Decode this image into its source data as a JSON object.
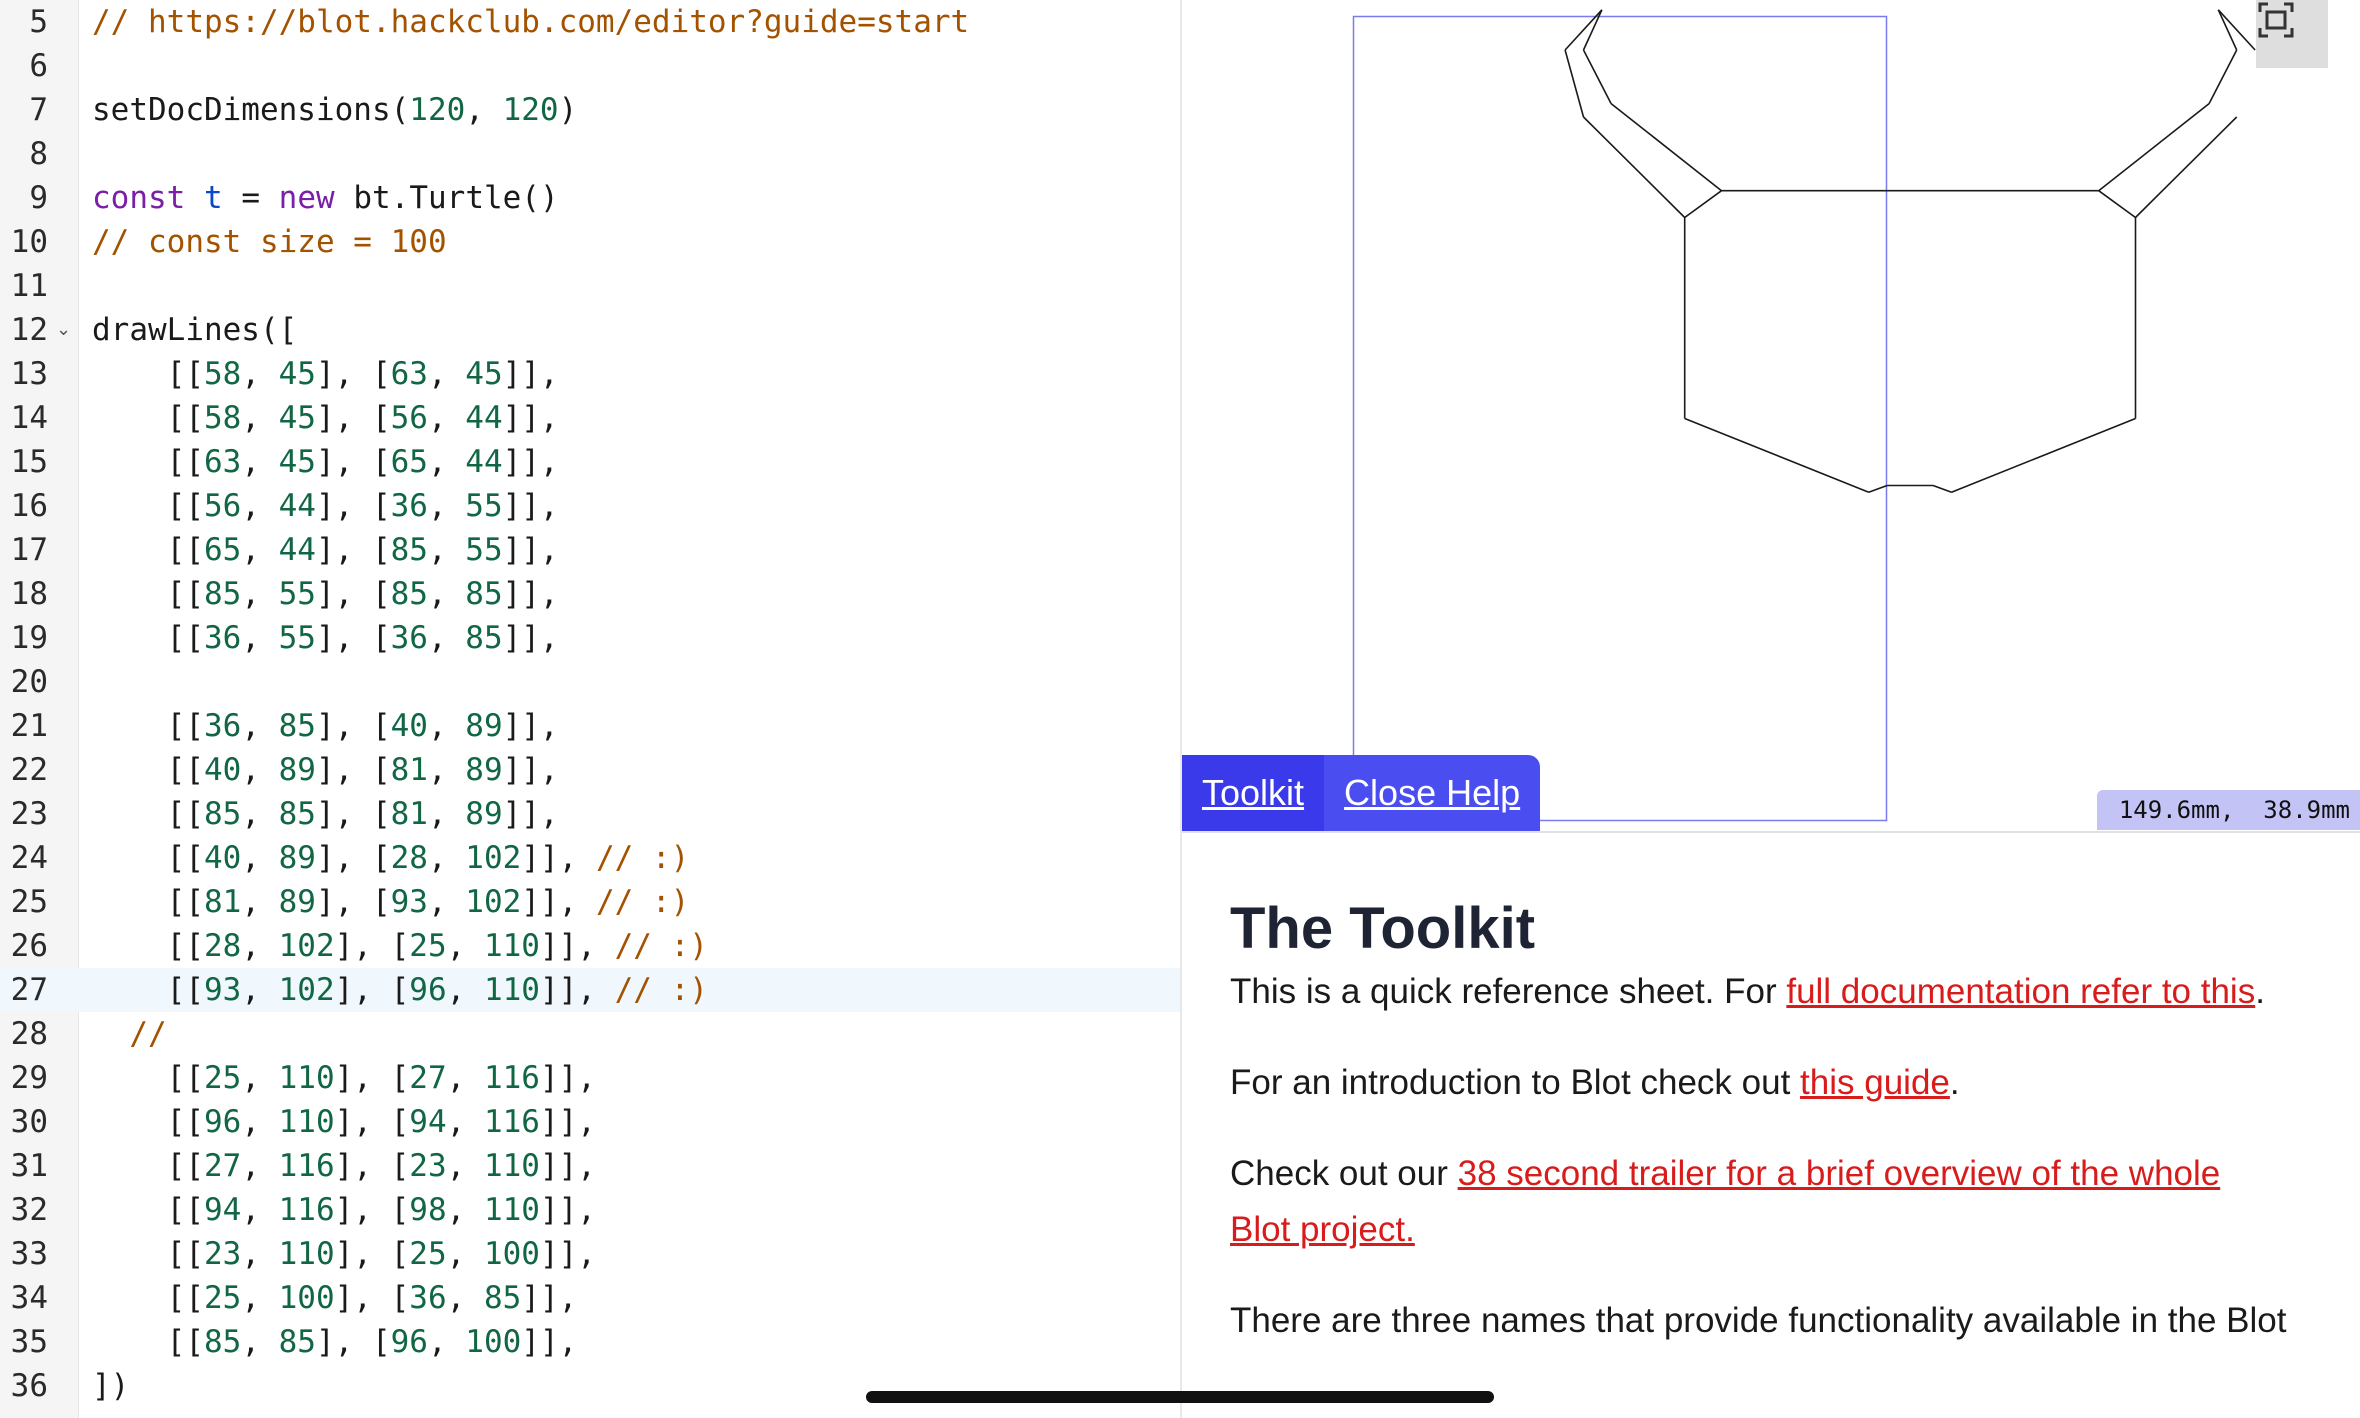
{
  "editor": {
    "lines": [
      {
        "num": "5",
        "tokens": [
          [
            "// https://blot.hackclub.com/editor?guide=start",
            "comment"
          ]
        ]
      },
      {
        "num": "6",
        "tokens": []
      },
      {
        "num": "7",
        "tokens": [
          [
            "setDocDimensions(",
            "plain"
          ],
          [
            "120",
            "num"
          ],
          [
            ", ",
            "plain"
          ],
          [
            "120",
            "num"
          ],
          [
            ")",
            "plain"
          ]
        ]
      },
      {
        "num": "8",
        "tokens": []
      },
      {
        "num": "9",
        "tokens": [
          [
            "const",
            "kw"
          ],
          [
            " ",
            "plain"
          ],
          [
            "t",
            "var"
          ],
          [
            " = ",
            "plain"
          ],
          [
            "new",
            "kw"
          ],
          [
            " bt.Turtle()",
            "plain"
          ]
        ]
      },
      {
        "num": "10",
        "tokens": [
          [
            "// const size = 100",
            "comment"
          ]
        ]
      },
      {
        "num": "11",
        "tokens": []
      },
      {
        "num": "12",
        "fold": true,
        "tokens": [
          [
            "drawLines([",
            "plain"
          ]
        ]
      },
      {
        "num": "13",
        "tokens": [
          [
            "    [[",
            "plain"
          ],
          [
            "58",
            "num"
          ],
          [
            ", ",
            "plain"
          ],
          [
            "45",
            "num"
          ],
          [
            "], [",
            "plain"
          ],
          [
            "63",
            "num"
          ],
          [
            ", ",
            "plain"
          ],
          [
            "45",
            "num"
          ],
          [
            "]],",
            "plain"
          ]
        ]
      },
      {
        "num": "14",
        "tokens": [
          [
            "    [[",
            "plain"
          ],
          [
            "58",
            "num"
          ],
          [
            ", ",
            "plain"
          ],
          [
            "45",
            "num"
          ],
          [
            "], [",
            "plain"
          ],
          [
            "56",
            "num"
          ],
          [
            ", ",
            "plain"
          ],
          [
            "44",
            "num"
          ],
          [
            "]],",
            "plain"
          ]
        ]
      },
      {
        "num": "15",
        "tokens": [
          [
            "    [[",
            "plain"
          ],
          [
            "63",
            "num"
          ],
          [
            ", ",
            "plain"
          ],
          [
            "45",
            "num"
          ],
          [
            "], [",
            "plain"
          ],
          [
            "65",
            "num"
          ],
          [
            ", ",
            "plain"
          ],
          [
            "44",
            "num"
          ],
          [
            "]],",
            "plain"
          ]
        ]
      },
      {
        "num": "16",
        "tokens": [
          [
            "    [[",
            "plain"
          ],
          [
            "56",
            "num"
          ],
          [
            ", ",
            "plain"
          ],
          [
            "44",
            "num"
          ],
          [
            "], [",
            "plain"
          ],
          [
            "36",
            "num"
          ],
          [
            ", ",
            "plain"
          ],
          [
            "55",
            "num"
          ],
          [
            "]],",
            "plain"
          ]
        ]
      },
      {
        "num": "17",
        "tokens": [
          [
            "    [[",
            "plain"
          ],
          [
            "65",
            "num"
          ],
          [
            ", ",
            "plain"
          ],
          [
            "44",
            "num"
          ],
          [
            "], [",
            "plain"
          ],
          [
            "85",
            "num"
          ],
          [
            ", ",
            "plain"
          ],
          [
            "55",
            "num"
          ],
          [
            "]],",
            "plain"
          ]
        ]
      },
      {
        "num": "18",
        "tokens": [
          [
            "    [[",
            "plain"
          ],
          [
            "85",
            "num"
          ],
          [
            ", ",
            "plain"
          ],
          [
            "55",
            "num"
          ],
          [
            "], [",
            "plain"
          ],
          [
            "85",
            "num"
          ],
          [
            ", ",
            "plain"
          ],
          [
            "85",
            "num"
          ],
          [
            "]],",
            "plain"
          ]
        ]
      },
      {
        "num": "19",
        "tokens": [
          [
            "    [[",
            "plain"
          ],
          [
            "36",
            "num"
          ],
          [
            ", ",
            "plain"
          ],
          [
            "55",
            "num"
          ],
          [
            "], [",
            "plain"
          ],
          [
            "36",
            "num"
          ],
          [
            ", ",
            "plain"
          ],
          [
            "85",
            "num"
          ],
          [
            "]],",
            "plain"
          ]
        ]
      },
      {
        "num": "20",
        "tokens": []
      },
      {
        "num": "21",
        "tokens": [
          [
            "    [[",
            "plain"
          ],
          [
            "36",
            "num"
          ],
          [
            ", ",
            "plain"
          ],
          [
            "85",
            "num"
          ],
          [
            "], [",
            "plain"
          ],
          [
            "40",
            "num"
          ],
          [
            ", ",
            "plain"
          ],
          [
            "89",
            "num"
          ],
          [
            "]],",
            "plain"
          ]
        ]
      },
      {
        "num": "22",
        "tokens": [
          [
            "    [[",
            "plain"
          ],
          [
            "40",
            "num"
          ],
          [
            ", ",
            "plain"
          ],
          [
            "89",
            "num"
          ],
          [
            "], [",
            "plain"
          ],
          [
            "81",
            "num"
          ],
          [
            ", ",
            "plain"
          ],
          [
            "89",
            "num"
          ],
          [
            "]],",
            "plain"
          ]
        ]
      },
      {
        "num": "23",
        "tokens": [
          [
            "    [[",
            "plain"
          ],
          [
            "85",
            "num"
          ],
          [
            ", ",
            "plain"
          ],
          [
            "85",
            "num"
          ],
          [
            "], [",
            "plain"
          ],
          [
            "81",
            "num"
          ],
          [
            ", ",
            "plain"
          ],
          [
            "89",
            "num"
          ],
          [
            "]],",
            "plain"
          ]
        ]
      },
      {
        "num": "24",
        "tokens": [
          [
            "    [[",
            "plain"
          ],
          [
            "40",
            "num"
          ],
          [
            ", ",
            "plain"
          ],
          [
            "89",
            "num"
          ],
          [
            "], [",
            "plain"
          ],
          [
            "28",
            "num"
          ],
          [
            ", ",
            "plain"
          ],
          [
            "102",
            "num"
          ],
          [
            "]], ",
            "plain"
          ],
          [
            "// :)",
            "comment"
          ]
        ]
      },
      {
        "num": "25",
        "tokens": [
          [
            "    [[",
            "plain"
          ],
          [
            "81",
            "num"
          ],
          [
            ", ",
            "plain"
          ],
          [
            "89",
            "num"
          ],
          [
            "], [",
            "plain"
          ],
          [
            "93",
            "num"
          ],
          [
            ", ",
            "plain"
          ],
          [
            "102",
            "num"
          ],
          [
            "]], ",
            "plain"
          ],
          [
            "// :)",
            "comment"
          ]
        ]
      },
      {
        "num": "26",
        "tokens": [
          [
            "    [[",
            "plain"
          ],
          [
            "28",
            "num"
          ],
          [
            ", ",
            "plain"
          ],
          [
            "102",
            "num"
          ],
          [
            "], [",
            "plain"
          ],
          [
            "25",
            "num"
          ],
          [
            ", ",
            "plain"
          ],
          [
            "110",
            "num"
          ],
          [
            "]], ",
            "plain"
          ],
          [
            "// :)",
            "comment"
          ]
        ]
      },
      {
        "num": "27",
        "active": true,
        "tokens": [
          [
            "    [[",
            "plain"
          ],
          [
            "93",
            "num"
          ],
          [
            ", ",
            "plain"
          ],
          [
            "102",
            "num"
          ],
          [
            "], [",
            "plain"
          ],
          [
            "96",
            "num"
          ],
          [
            ", ",
            "plain"
          ],
          [
            "110",
            "num"
          ],
          [
            "]], ",
            "plain"
          ],
          [
            "// :)",
            "comment"
          ]
        ]
      },
      {
        "num": "28",
        "tokens": [
          [
            "  ",
            "plain"
          ],
          [
            "//",
            "comment"
          ]
        ]
      },
      {
        "num": "29",
        "tokens": [
          [
            "    [[",
            "plain"
          ],
          [
            "25",
            "num"
          ],
          [
            ", ",
            "plain"
          ],
          [
            "110",
            "num"
          ],
          [
            "], [",
            "plain"
          ],
          [
            "27",
            "num"
          ],
          [
            ", ",
            "plain"
          ],
          [
            "116",
            "num"
          ],
          [
            "]],",
            "plain"
          ]
        ]
      },
      {
        "num": "30",
        "tokens": [
          [
            "    [[",
            "plain"
          ],
          [
            "96",
            "num"
          ],
          [
            ", ",
            "plain"
          ],
          [
            "110",
            "num"
          ],
          [
            "], [",
            "plain"
          ],
          [
            "94",
            "num"
          ],
          [
            ", ",
            "plain"
          ],
          [
            "116",
            "num"
          ],
          [
            "]],",
            "plain"
          ]
        ]
      },
      {
        "num": "31",
        "tokens": [
          [
            "    [[",
            "plain"
          ],
          [
            "27",
            "num"
          ],
          [
            ", ",
            "plain"
          ],
          [
            "116",
            "num"
          ],
          [
            "], [",
            "plain"
          ],
          [
            "23",
            "num"
          ],
          [
            ", ",
            "plain"
          ],
          [
            "110",
            "num"
          ],
          [
            "]],",
            "plain"
          ]
        ]
      },
      {
        "num": "32",
        "tokens": [
          [
            "    [[",
            "plain"
          ],
          [
            "94",
            "num"
          ],
          [
            ", ",
            "plain"
          ],
          [
            "116",
            "num"
          ],
          [
            "], [",
            "plain"
          ],
          [
            "98",
            "num"
          ],
          [
            ", ",
            "plain"
          ],
          [
            "110",
            "num"
          ],
          [
            "]],",
            "plain"
          ]
        ]
      },
      {
        "num": "33",
        "tokens": [
          [
            "    [[",
            "plain"
          ],
          [
            "23",
            "num"
          ],
          [
            ", ",
            "plain"
          ],
          [
            "110",
            "num"
          ],
          [
            "], [",
            "plain"
          ],
          [
            "25",
            "num"
          ],
          [
            ", ",
            "plain"
          ],
          [
            "100",
            "num"
          ],
          [
            "]],",
            "plain"
          ]
        ]
      },
      {
        "num": "34",
        "tokens": [
          [
            "    [[",
            "plain"
          ],
          [
            "25",
            "num"
          ],
          [
            ", ",
            "plain"
          ],
          [
            "100",
            "num"
          ],
          [
            "], [",
            "plain"
          ],
          [
            "36",
            "num"
          ],
          [
            ", ",
            "plain"
          ],
          [
            "85",
            "num"
          ],
          [
            "]],",
            "plain"
          ]
        ]
      },
      {
        "num": "35",
        "tokens": [
          [
            "    [[",
            "plain"
          ],
          [
            "85",
            "num"
          ],
          [
            ", ",
            "plain"
          ],
          [
            "85",
            "num"
          ],
          [
            "], [",
            "plain"
          ],
          [
            "96",
            "num"
          ],
          [
            ", ",
            "plain"
          ],
          [
            "100",
            "num"
          ],
          [
            "]],",
            "plain"
          ]
        ]
      },
      {
        "num": "36",
        "tokens": [
          [
            "])",
            "plain"
          ]
        ]
      }
    ]
  },
  "preview": {
    "doc_dimensions": [
      120,
      120
    ],
    "lines": [
      [
        [
          58,
          45
        ],
        [
          63,
          45
        ]
      ],
      [
        [
          58,
          45
        ],
        [
          56,
          44
        ]
      ],
      [
        [
          63,
          45
        ],
        [
          65,
          44
        ]
      ],
      [
        [
          56,
          44
        ],
        [
          36,
          55
        ]
      ],
      [
        [
          65,
          44
        ],
        [
          85,
          55
        ]
      ],
      [
        [
          85,
          55
        ],
        [
          85,
          85
        ]
      ],
      [
        [
          36,
          55
        ],
        [
          36,
          85
        ]
      ],
      [
        [
          36,
          85
        ],
        [
          40,
          89
        ]
      ],
      [
        [
          40,
          89
        ],
        [
          81,
          89
        ]
      ],
      [
        [
          85,
          85
        ],
        [
          81,
          89
        ]
      ],
      [
        [
          40,
          89
        ],
        [
          28,
          102
        ]
      ],
      [
        [
          81,
          89
        ],
        [
          93,
          102
        ]
      ],
      [
        [
          28,
          102
        ],
        [
          25,
          110
        ]
      ],
      [
        [
          93,
          102
        ],
        [
          96,
          110
        ]
      ],
      [
        [
          25,
          110
        ],
        [
          27,
          116
        ]
      ],
      [
        [
          96,
          110
        ],
        [
          94,
          116
        ]
      ],
      [
        [
          27,
          116
        ],
        [
          23,
          110
        ]
      ],
      [
        [
          94,
          116
        ],
        [
          98,
          110
        ]
      ],
      [
        [
          23,
          110
        ],
        [
          25,
          100
        ]
      ],
      [
        [
          25,
          100
        ],
        [
          36,
          85
        ]
      ],
      [
        [
          85,
          85
        ],
        [
          96,
          100
        ]
      ]
    ],
    "fullscreen_icon": "fullscreen-icon",
    "coordinates": "149.6mm,  38.9mm",
    "colors": {
      "doc_border": "#7b7bf0",
      "stroke": "#1a1a1a",
      "readout_bg": "#c3c3f5"
    }
  },
  "help_tabs": {
    "toolkit": "Toolkit",
    "close": "Close Help",
    "color": "#3a3aea"
  },
  "help": {
    "title": "The Toolkit",
    "p1_before": "This is a quick reference sheet. For ",
    "p1_link": "full documentation refer to this",
    "p1_after": ".",
    "p2_before": "For an introduction to Blot check out ",
    "p2_link": "this guide",
    "p2_after": ".",
    "p3_before": "Check out our ",
    "p3_link_line1": "38 second trailer for a brief overview of the whole",
    "p3_link_line2": "Blot project.",
    "p4": "There are three names that provide functionality available in the Blot",
    "link_color": "#d81b1b"
  }
}
